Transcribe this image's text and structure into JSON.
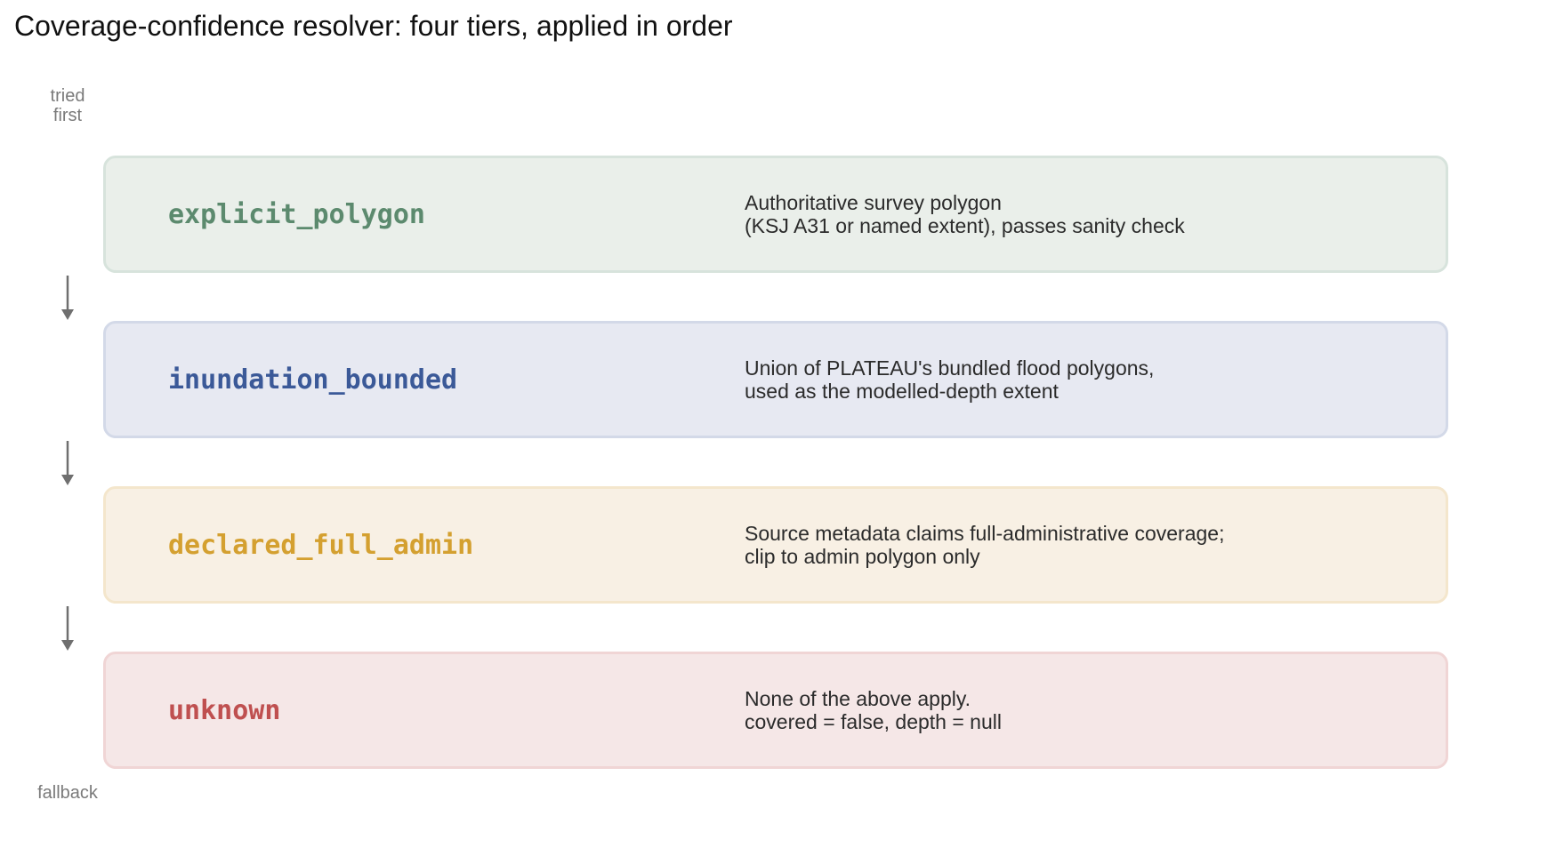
{
  "title": "Coverage-confidence resolver: four tiers, applied in order",
  "labels": {
    "top_line1": "tried",
    "top_line2": "first",
    "bottom": "fallback"
  },
  "colors": {
    "arrow": "#6f6f6f"
  },
  "tiers": [
    {
      "name": "explicit_polygon",
      "desc_line1": "Authoritative survey polygon",
      "desc_line2": "(KSJ A31 or named extent), passes sanity check",
      "text_color": "#5c8a6e",
      "fill": "#eaefea",
      "border": "#d7e3dc"
    },
    {
      "name": "inundation_bounded",
      "desc_line1": "Union of PLATEAU's bundled flood polygons,",
      "desc_line2": "used as the modelled-depth extent",
      "text_color": "#3b5998",
      "fill": "#e7e9f2",
      "border": "#d3d9e8"
    },
    {
      "name": "declared_full_admin",
      "desc_line1": "Source metadata claims full-administrative coverage;",
      "desc_line2": "clip to admin polygon only",
      "text_color": "#d4a030",
      "fill": "#f8f0e4",
      "border": "#f4e6cc"
    },
    {
      "name": "unknown",
      "desc_line1": "None of the above apply.",
      "desc_line2": "covered = false, depth = null",
      "text_color": "#bf5050",
      "fill": "#f5e7e7",
      "border": "#f0d5d5"
    }
  ]
}
